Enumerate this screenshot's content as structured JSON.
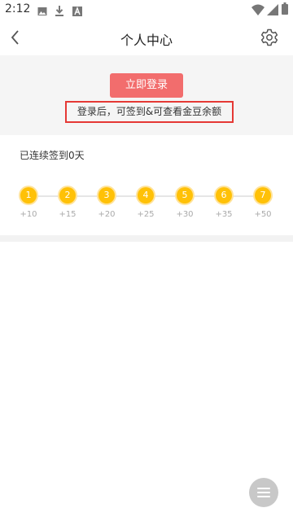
{
  "status_bar": {
    "time": "2:12",
    "left_icons": [
      "gallery-icon",
      "download-icon",
      "font-icon"
    ],
    "right_icons": [
      "wifi-icon",
      "signal-icon",
      "battery-icon"
    ]
  },
  "nav": {
    "title": "个人中心",
    "back_icon": "chevron-left-icon",
    "settings_icon": "gear-icon"
  },
  "login": {
    "button_label": "立即登录",
    "hint": "登录后，可签到&可查看金豆余额",
    "accent_color": "#f26d6d",
    "highlight_color": "#e53935"
  },
  "checkin": {
    "title": "已连续签到0天",
    "node_color": "#ffc107",
    "days": [
      {
        "day": "1",
        "reward": "+10"
      },
      {
        "day": "2",
        "reward": "+15"
      },
      {
        "day": "3",
        "reward": "+20"
      },
      {
        "day": "4",
        "reward": "+25"
      },
      {
        "day": "5",
        "reward": "+30"
      },
      {
        "day": "6",
        "reward": "+35"
      },
      {
        "day": "7",
        "reward": "+50"
      }
    ]
  },
  "floating": {
    "menu_icon": "menu-icon"
  }
}
